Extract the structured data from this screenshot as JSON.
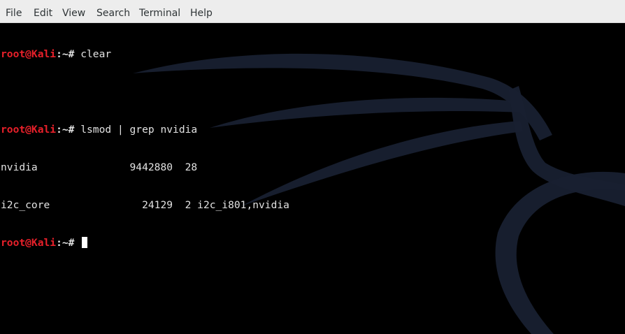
{
  "menubar": {
    "items": [
      "File",
      "Edit",
      "View",
      "Search",
      "Terminal",
      "Help"
    ]
  },
  "terminal": {
    "prompt": {
      "user_host": "root@Kali",
      "path": ":~",
      "symbol": "# "
    },
    "lines": [
      {
        "type": "prompt",
        "command": "clear"
      },
      {
        "type": "blank",
        "text": ""
      },
      {
        "type": "prompt",
        "command": "lsmod | grep nvidia"
      },
      {
        "type": "output",
        "text": "nvidia               9442880  28"
      },
      {
        "type": "output",
        "text": "i2c_core               24129  2 i2c_i801,nvidia"
      },
      {
        "type": "prompt",
        "command": "",
        "cursor": true
      }
    ]
  },
  "colors": {
    "background": "#000000",
    "prompt_user": "#e8202a",
    "text": "#e2e2e2",
    "menubar_bg": "#ededed",
    "dragon": "#1a2230"
  },
  "icons": {
    "background_logo": "kali-dragon-icon"
  }
}
